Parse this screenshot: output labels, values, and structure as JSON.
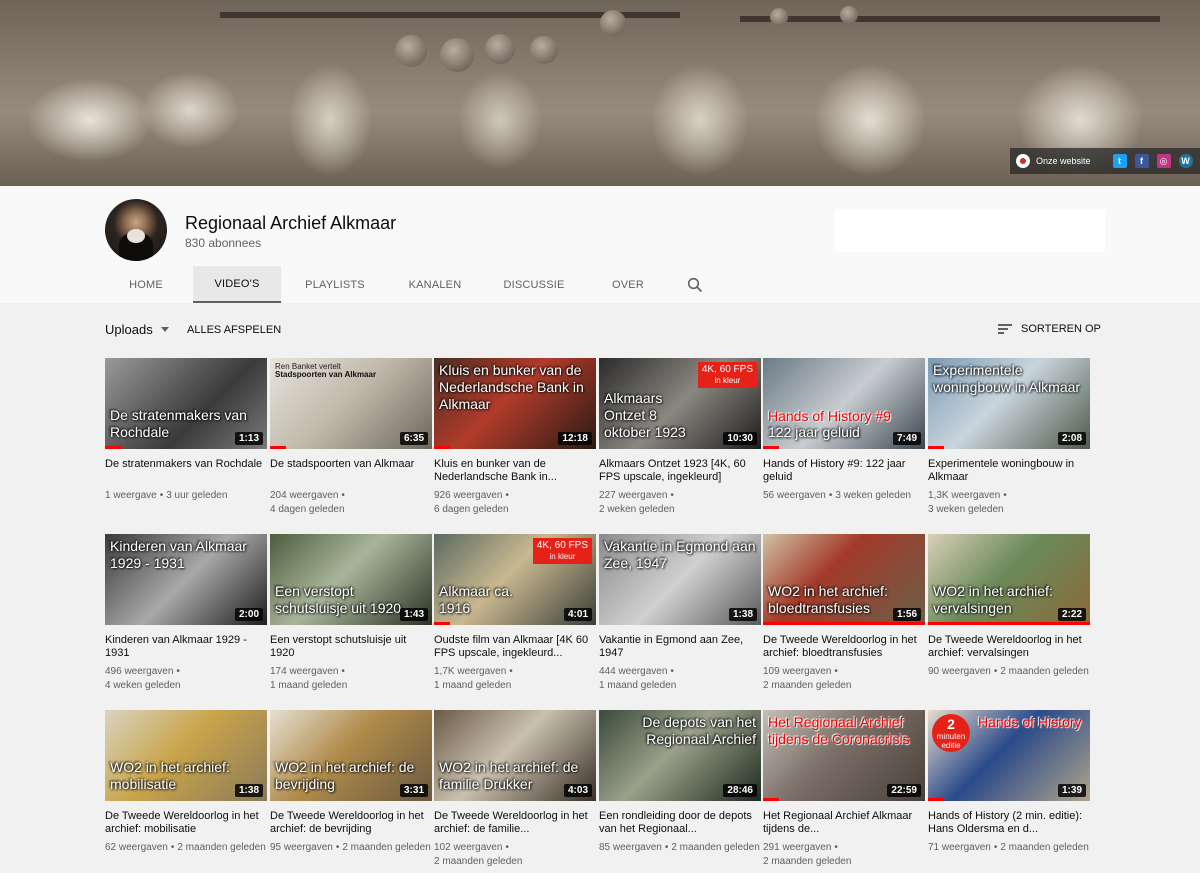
{
  "banner": {
    "website_label": "Onze website",
    "social_icons": [
      "twitter-icon",
      "facebook-icon",
      "instagram-icon",
      "wordpress-icon"
    ],
    "social_colors": [
      "#1da1f2",
      "#3b5998",
      "#c13584",
      "#21759b"
    ]
  },
  "channel": {
    "name": "Regionaal Archief Alkmaar",
    "subscribers": "830 abonnees"
  },
  "tabs": [
    {
      "label": "HOME"
    },
    {
      "label": "VIDEO'S",
      "active": true
    },
    {
      "label": "PLAYLISTS"
    },
    {
      "label": "KANALEN"
    },
    {
      "label": "DISCUSSIE"
    },
    {
      "label": "OVER"
    }
  ],
  "toolbar": {
    "uploads": "Uploads",
    "play_all": "ALLES AFSPELEN",
    "sort": "SORTEREN OP"
  },
  "colors": {
    "accent": "#ff0000",
    "badge": "#e62117"
  },
  "videos": [
    {
      "title": "De stratenmakers van Rochdale",
      "views": "1 weergave",
      "age": "3 uur geleden",
      "duration": "1:13",
      "overlay": "De stratenmakers van Rochdale",
      "progress": 0.1
    },
    {
      "title": "De stadspoorten van Alkmaar",
      "views": "204 weergaven",
      "age": "4 dagen geleden",
      "duration": "6:35",
      "overlay_small": "Ren Banket vertelt",
      "overlay": "Stadspoorten van Alkmaar",
      "progress": 0.1
    },
    {
      "title": "Kluis en bunker van de Nederlandsche Bank in...",
      "views": "926 weergaven",
      "age": "6 dagen geleden",
      "duration": "12:18",
      "overlay": "Kluis en bunker van de Nederlandsche Bank in Alkmaar",
      "progress": 0.1
    },
    {
      "title": "Alkmaars Ontzet 1923 [4K, 60 FPS upscale, ingekleurd]",
      "views": "227 weergaven",
      "age": "2 weken geleden",
      "duration": "10:30",
      "overlay": "Alkmaars Ontzet 8 oktober 1923",
      "badge": "4K, 60 FPS",
      "badge_sub": "in kleur",
      "progress": 0
    },
    {
      "title": "Hands of History #9: 122 jaar geluid",
      "views": "56 weergaven",
      "age": "3 weken geleden",
      "duration": "7:49",
      "overlay_red": "Hands of History #9",
      "overlay": "122 jaar geluid",
      "progress": 0.1
    },
    {
      "title": "Experimentele woningbouw in Alkmaar",
      "views": "1,3K weergaven",
      "age": "3 weken geleden",
      "duration": "2:08",
      "overlay": "Experimentele woningbouw in Alkmaar",
      "progress": 0.1
    },
    {
      "title": "Kinderen van Alkmaar 1929 - 1931",
      "views": "496 weergaven",
      "age": "4 weken geleden",
      "duration": "2:00",
      "overlay": "Kinderen van Alkmaar 1929 - 1931",
      "progress": 0
    },
    {
      "title": "Een verstopt schutsluisje uit 1920",
      "views": "174 weergaven",
      "age": "1 maand geleden",
      "duration": "1:43",
      "overlay": "Een verstopt schutsluisje uit 1920",
      "progress": 0
    },
    {
      "title": "Oudste film van Alkmaar [4K 60 FPS upscale, ingekleurd...",
      "views": "1,7K weergaven",
      "age": "1 maand geleden",
      "duration": "4:01",
      "overlay": "Alkmaar ca. 1916",
      "badge": "4K, 60 FPS",
      "badge_sub": "in kleur",
      "progress": 0.1
    },
    {
      "title": "Vakantie in Egmond aan Zee, 1947",
      "views": "444 weergaven",
      "age": "1 maand geleden",
      "duration": "1:38",
      "overlay": "Vakantie in Egmond aan Zee, 1947",
      "progress": 0
    },
    {
      "title": "De Tweede Wereldoorlog in het archief: bloedtransfusies",
      "views": "109 weergaven",
      "age": "2 maanden geleden",
      "duration": "1:56",
      "overlay": "WO2 in het archief: bloedtransfusies",
      "progress": 1
    },
    {
      "title": "De Tweede Wereldoorlog in het archief: vervalsingen",
      "views": "90 weergaven",
      "age": "2 maanden geleden",
      "duration": "2:22",
      "overlay": "WO2 in het archief: vervalsingen",
      "progress": 1
    },
    {
      "title": "De Tweede Wereldoorlog in het archief: mobilisatie",
      "views": "62 weergaven",
      "age": "2 maanden geleden",
      "duration": "1:38",
      "overlay": "WO2 in het archief: mobilisatie",
      "progress": 0
    },
    {
      "title": "De Tweede Wereldoorlog in het archief: de bevrijding",
      "views": "95 weergaven",
      "age": "2 maanden geleden",
      "duration": "3:31",
      "overlay": "WO2 in het archief: de bevrijding",
      "progress": 0
    },
    {
      "title": "De Tweede Wereldoorlog in het archief: de familie...",
      "views": "102 weergaven",
      "age": "2 maanden geleden",
      "duration": "4:03",
      "overlay": "WO2 in het archief: de familie Drukker",
      "progress": 0
    },
    {
      "title": "Een rondleiding door de depots van het Regionaal...",
      "views": "85 weergaven",
      "age": "2 maanden geleden",
      "duration": "28:46",
      "overlay_top": "De depots van het Regionaal Archief",
      "progress": 0
    },
    {
      "title": "Het Regionaal Archief Alkmaar tijdens de...",
      "views": "291 weergaven",
      "age": "2 maanden geleden",
      "duration": "22:59",
      "overlay_red_top": "Het Regionaal Archief tijdens de Coronacrisis",
      "progress": 0.1
    },
    {
      "title": "Hands of History (2 min. editie): Hans Oldersma en d...",
      "views": "71 weergaven",
      "age": "2 maanden geleden",
      "duration": "1:39",
      "overlay_red_top": "Hands of History",
      "circle_num": "2",
      "circle_text": "minuten editie",
      "progress": 0.1
    }
  ]
}
